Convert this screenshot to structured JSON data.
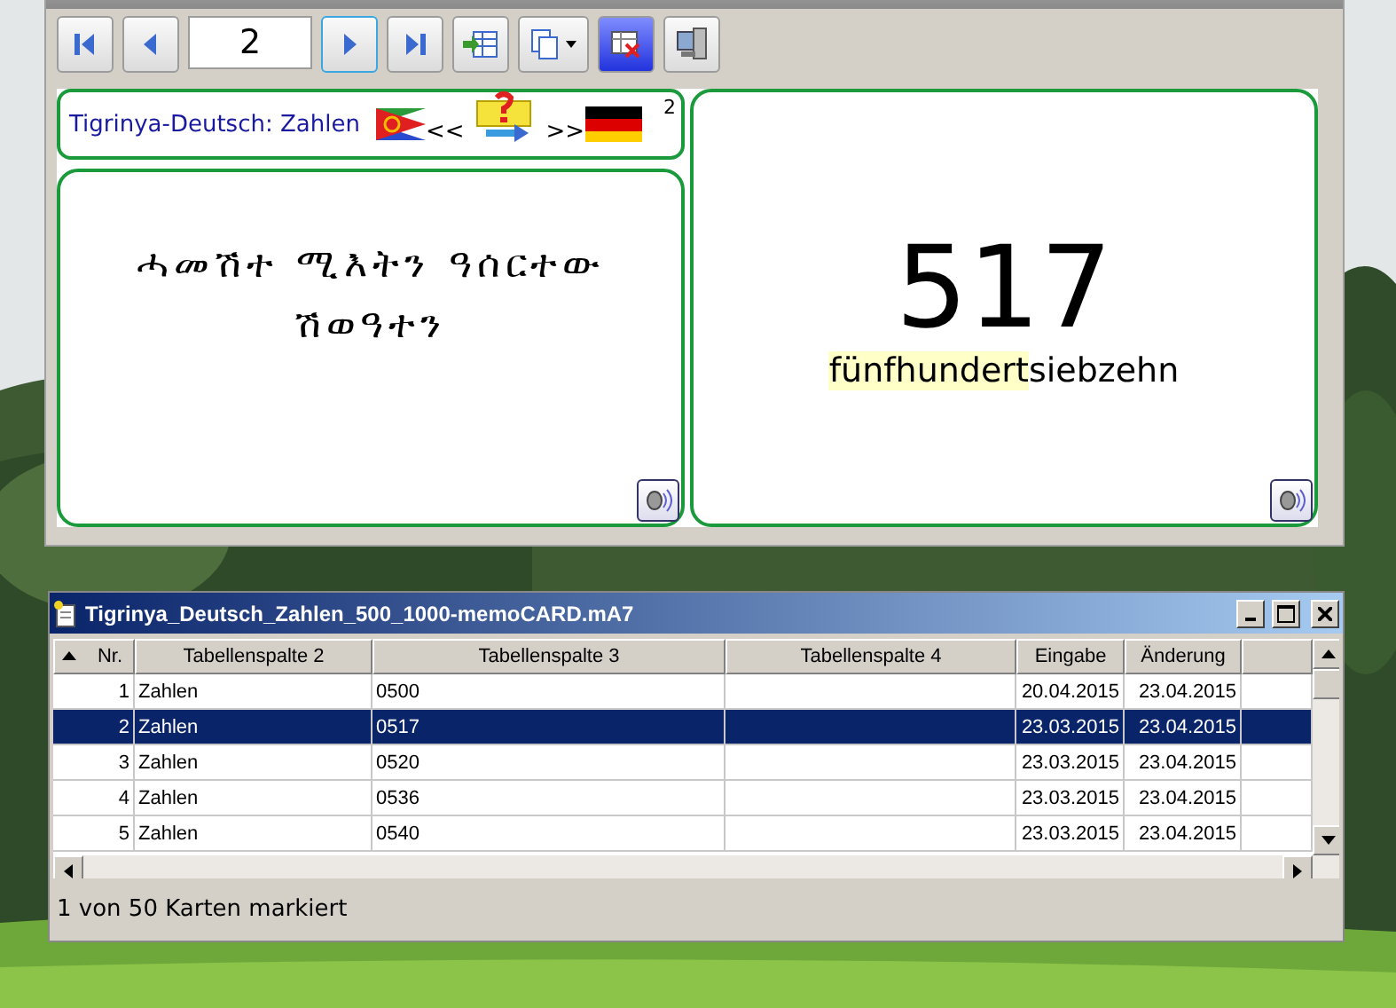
{
  "toolbar": {
    "page": "2",
    "buttons": [
      {
        "kind": "first",
        "focused": false
      },
      {
        "kind": "prev",
        "focused": false
      },
      {
        "kind": "page",
        "focused": false
      },
      {
        "kind": "next",
        "focused": true
      },
      {
        "kind": "last",
        "focused": false
      },
      {
        "kind": "import",
        "focused": false
      },
      {
        "kind": "copy",
        "focused": false
      },
      {
        "kind": "delete",
        "focused": false
      },
      {
        "kind": "network",
        "focused": false
      }
    ]
  },
  "card_header": {
    "title": "Tigrinya-Deutsch: Zahlen",
    "left_arrows": "<<",
    "right_arrows": ">>",
    "count": "2"
  },
  "question": {
    "text": "ሓመሽተ ሚእትን ዓሰርተው ሽወዓተን"
  },
  "answer": {
    "number": "517",
    "highlighted": "fünfhundert",
    "rest": "siebzehn"
  },
  "list_window": {
    "title": "Tigrinya_Deutsch_Zahlen_500_1000-memoCARD.mA7",
    "columns": [
      "Nr.",
      "Tabellenspalte 2",
      "Tabellenspalte 3",
      "Tabellenspalte 4",
      "Eingabe",
      "Änderung"
    ],
    "rows": [
      {
        "cells": [
          "1",
          "Zahlen",
          "0500",
          "",
          "20.04.2015",
          "23.04.2015"
        ],
        "selected": false
      },
      {
        "cells": [
          "2",
          "Zahlen",
          "0517",
          "",
          "23.03.2015",
          "23.04.2015"
        ],
        "selected": true
      },
      {
        "cells": [
          "3",
          "Zahlen",
          "0520",
          "",
          "23.03.2015",
          "23.04.2015"
        ],
        "selected": false
      },
      {
        "cells": [
          "4",
          "Zahlen",
          "0536",
          "",
          "23.03.2015",
          "23.04.2015"
        ],
        "selected": false
      },
      {
        "cells": [
          "5",
          "Zahlen",
          "0540",
          "",
          "23.03.2015",
          "23.04.2015"
        ],
        "selected": false
      }
    ],
    "status": "1 von 50 Karten markiert"
  }
}
